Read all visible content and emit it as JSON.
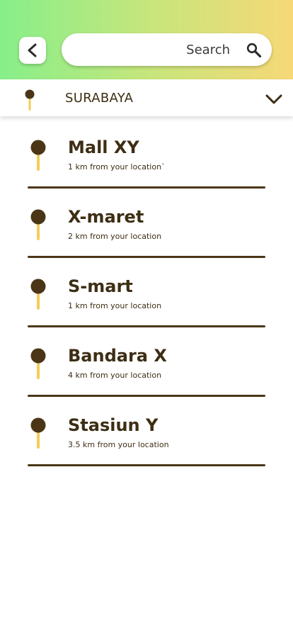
{
  "header": {
    "back_icon": "chevron-left-icon",
    "search_placeholder": "Search",
    "search_value": "",
    "search_icon": "search-icon"
  },
  "city": {
    "name": "SURABAYA",
    "pin_icon": "location-pin-icon",
    "dropdown_icon": "chevron-down-icon"
  },
  "colors": {
    "gradient_start": "#86ef8a",
    "gradient_end": "#f7d877",
    "pin_head": "#4a3616",
    "pin_stick": "#f5cc5a",
    "text": "#3d2e14"
  },
  "locations": [
    {
      "name": "Mall XY",
      "distance": "1 km from your location`"
    },
    {
      "name": "X-maret",
      "distance": "2 km from your location"
    },
    {
      "name": "S-mart",
      "distance": "1 km from your location"
    },
    {
      "name": "Bandara X",
      "distance": "4 km from your location"
    },
    {
      "name": "Stasiun Y",
      "distance": "3.5 km from your location"
    }
  ]
}
